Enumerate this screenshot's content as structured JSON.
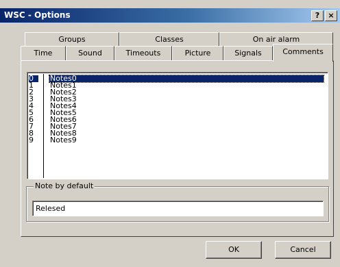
{
  "window": {
    "title": "WSC - Options",
    "help_label": "?",
    "close_label": "×"
  },
  "tabs": {
    "row_back": [
      {
        "label": "Groups"
      },
      {
        "label": "Classes"
      },
      {
        "label": "On air alarm"
      }
    ],
    "row_front": [
      {
        "label": "Time"
      },
      {
        "label": "Sound"
      },
      {
        "label": "Timeouts"
      },
      {
        "label": "Picture"
      },
      {
        "label": "Signals"
      },
      {
        "label": "Comments"
      }
    ],
    "active": "Comments"
  },
  "notes_list": {
    "numbers": [
      "0",
      "1",
      "2",
      "3",
      "4",
      "5",
      "6",
      "7",
      "8",
      "9"
    ],
    "items": [
      "Notes0",
      "Notes1",
      "Notes2",
      "Notes3",
      "Notes4",
      "Notes5",
      "Notes6",
      "Notes7",
      "Notes8",
      "Notes9"
    ],
    "selected_index": 0
  },
  "default_note": {
    "label": "Note by default",
    "value": "Relesed"
  },
  "buttons": {
    "ok": "OK",
    "cancel": "Cancel"
  },
  "colors": {
    "selection": "#0a246a",
    "dialog_face": "#d4d0c8"
  }
}
